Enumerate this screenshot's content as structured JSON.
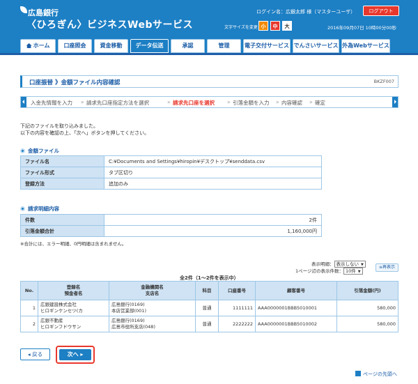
{
  "header": {
    "bank_name": "広島銀行",
    "service_name": "〈ひろぎん〉ビジネスWebサービス",
    "login_name": "ログイン名：広銀太郎 様（マスターユーザ）",
    "logout_label": "ログアウト",
    "font_size_label": "文字サイズを変更",
    "font_small": "小",
    "font_mid": "中",
    "font_large": "大",
    "datetime": "2016年09月07日 10時00分00秒"
  },
  "nav": {
    "tabs": [
      {
        "label": "ホーム"
      },
      {
        "label": "口座照会"
      },
      {
        "label": "資金移動"
      },
      {
        "label": "データ伝送"
      },
      {
        "label": "承認"
      },
      {
        "label": "管理"
      },
      {
        "label": "電子交付サービス"
      },
      {
        "label": "でんさいサービス"
      },
      {
        "label": "外為Webサービス"
      }
    ]
  },
  "page": {
    "title": "口座振替 》金額ファイル内容確認",
    "screen_id": "BKZF007",
    "steps": [
      "入金先情報を入力",
      "請求先口座指定方法を選択",
      "請求先口座を選択",
      "引落金額を入力",
      "内容確認",
      "確定"
    ],
    "intro_1": "下記のファイルを取り込みました。",
    "intro_2": "以下の内容を確認の上、「次へ」ボタンを押してください。"
  },
  "file_section": {
    "heading": "金額ファイル",
    "rows": [
      {
        "key": "ファイル名",
        "value": "C:¥Documents and Settings¥hiropin¥デスクトップ¥senddata.csv"
      },
      {
        "key": "ファイル形式",
        "value": "タブ区切り"
      },
      {
        "key": "登録方法",
        "value": "追加のみ"
      }
    ]
  },
  "summary_section": {
    "heading": "請求明細内容",
    "rows": [
      {
        "key": "件数",
        "value": "2件"
      },
      {
        "key": "引落金額合計",
        "value": "1,160,000円"
      }
    ],
    "note": "※合計には、エラー明細、0円明細は含まれません。"
  },
  "list_controls": {
    "detail_label": "表示明細：",
    "detail_value": "表示しない",
    "count_label": "1ページ辺の表示件数：",
    "count_value": "10件",
    "redisplay_label": "再表示",
    "count_line": "全2件（1～2件を表示中）"
  },
  "list": {
    "headers": {
      "no": "No.",
      "name_1": "登録名",
      "name_2": "預金者名",
      "bank_1": "金融機関名",
      "bank_2": "支店名",
      "subject": "科目",
      "account": "口座番号",
      "customer": "顧客番号",
      "amount": "引落金額(円)"
    },
    "rows": [
      {
        "no": "1",
        "name": "広銀建設株式会社",
        "kana": "ヒロギンケンセツ(カ",
        "bank": "広島銀行(0169)",
        "branch": "本店営業部(001)",
        "subject": "普通",
        "account": "1111111",
        "customer": "AAA0000001BBB5010001",
        "amount": "580,000"
      },
      {
        "no": "2",
        "name": "広銀不動産",
        "kana": "ヒロギンフドウサン",
        "bank": "広島銀行(0169)",
        "branch": "広島市役所支店(048)",
        "subject": "普通",
        "account": "2222222",
        "customer": "AAA0000001BBB5010002",
        "amount": "580,000"
      }
    ]
  },
  "buttons": {
    "back": "戻る",
    "next": "次へ"
  },
  "pagetop": "ページの先頭へ"
}
